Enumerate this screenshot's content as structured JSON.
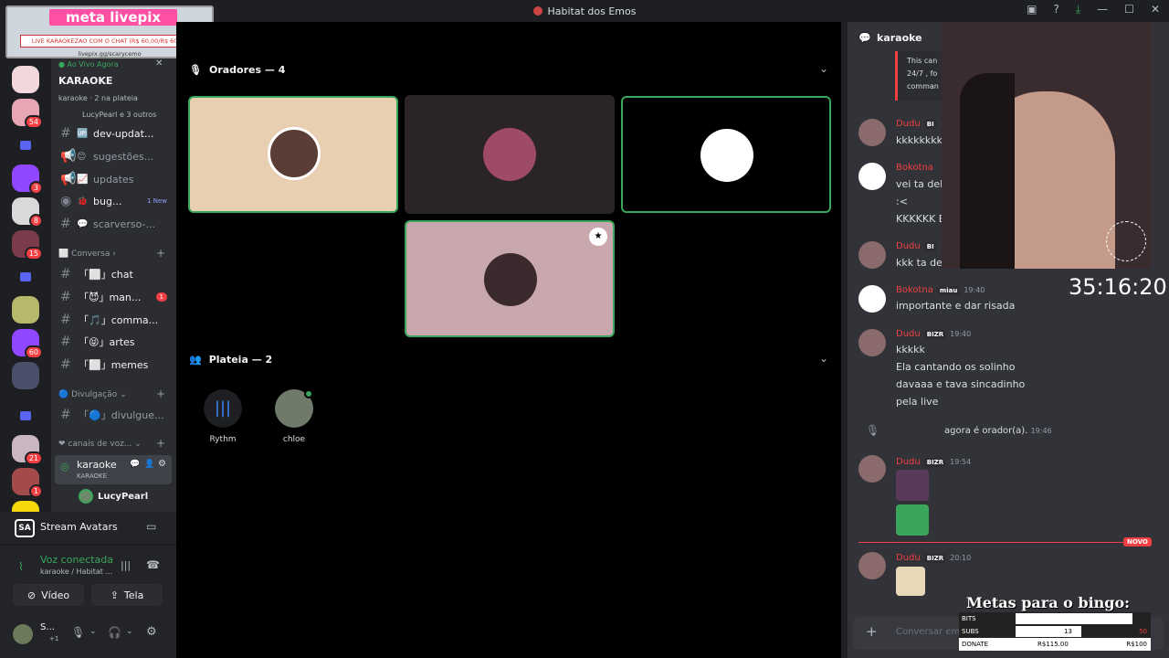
{
  "window": {
    "title": "Habitat dos Emos"
  },
  "livepix": {
    "brand": "meta livepix",
    "goal": "LIVE KARAOKEZAO COM O CHAT (R$ 60,00/R$ 60,00)",
    "url": "livepix.gg/scarycemo"
  },
  "stage": {
    "live_label": "Ao Vivo Agora",
    "name": "KARAOKE",
    "meta": "karaoke · 2 na plateia",
    "members": "LucyPearl e 3 outros"
  },
  "guild_badges": [
    "54",
    "3",
    "8",
    "21",
    "15",
    "60",
    "21",
    "1"
  ],
  "channels": [
    {
      "emoji": "🆙",
      "name": "dev-updat..."
    },
    {
      "emoji": "😊",
      "name": "sugestões..."
    },
    {
      "emoji": "📈",
      "name": "updates"
    },
    {
      "emoji": "🐞",
      "name": "bug...",
      "badge": "1 New"
    },
    {
      "emoji": "💬",
      "name": "scarverso-..."
    }
  ],
  "cat_conversa": "Conversa",
  "conversa_channels": [
    {
      "name": "「⬜」chat"
    },
    {
      "name": "「😈」man...",
      "badge": "1"
    },
    {
      "name": "「🎵」comma..."
    },
    {
      "name": "「😝」artes"
    },
    {
      "name": "「⬜」memes"
    }
  ],
  "cat_divulgacao": "Divulgação",
  "divulg_channel": "「🔵」divulgue...",
  "cat_voice": "canais de voz...",
  "voice": {
    "name": "karaoke",
    "sub": "KARAOKE",
    "user": "LucyPearl"
  },
  "stream_avatars": "Stream Avatars",
  "connection": {
    "status": "Voz conectada",
    "detail": "karaoke / Habitat ..."
  },
  "buttons": {
    "video": "Vídeo",
    "screen": "Tela"
  },
  "user": {
    "name": "S...",
    "sub": "+1"
  },
  "speakers_header": "Oradores — 4",
  "audience_header": "Plateia — 2",
  "audience": [
    {
      "name": "Rythm"
    },
    {
      "name": "chloe"
    }
  ],
  "chat": {
    "title": "karaoke",
    "system_lines": [
      "This can",
      "24/7 , fo",
      "comman"
    ],
    "messages": [
      {
        "name": "Dudu",
        "tag": "BI",
        "lines": [
          "kkkkkkkkk"
        ],
        "time": ""
      },
      {
        "name": "Bokotna",
        "tag": "",
        "lines": [
          "vei ta dela",
          ":<",
          "KKKKKK E"
        ],
        "time": ""
      },
      {
        "name": "Dudu",
        "tag": "BI",
        "lines": [
          "kkk ta dela"
        ],
        "time": ""
      },
      {
        "name": "Bokotna",
        "tag": "miau",
        "lines": [
          "importante e dar risada"
        ],
        "time": "19:40"
      },
      {
        "name": "Dudu",
        "tag": "BIZR",
        "lines": [
          "kkkkk",
          "Ela cantando os solinho",
          "davaaa e tava sincadinho",
          "pela live"
        ],
        "time": "19:40"
      }
    ],
    "system_msg": "agora é orador(a).",
    "system_time": "19:46",
    "msg_time_1": "19:54",
    "msg_time_2": "20:10",
    "msg_name": "Dudu",
    "msg_tag": "BIZR",
    "new_label": "NOVO",
    "input_placeholder": "Conversar em"
  },
  "overlay": {
    "timer": "35:16:20",
    "bingo_title": "Metas para o bingo:",
    "bingo_rows": [
      {
        "label": "BITS",
        "value": "",
        "goal": ""
      },
      {
        "label": "SUBS",
        "value": "13",
        "goal": "50"
      },
      {
        "label": "DONATE",
        "value": "R$115.00",
        "goal": "R$100"
      }
    ]
  }
}
